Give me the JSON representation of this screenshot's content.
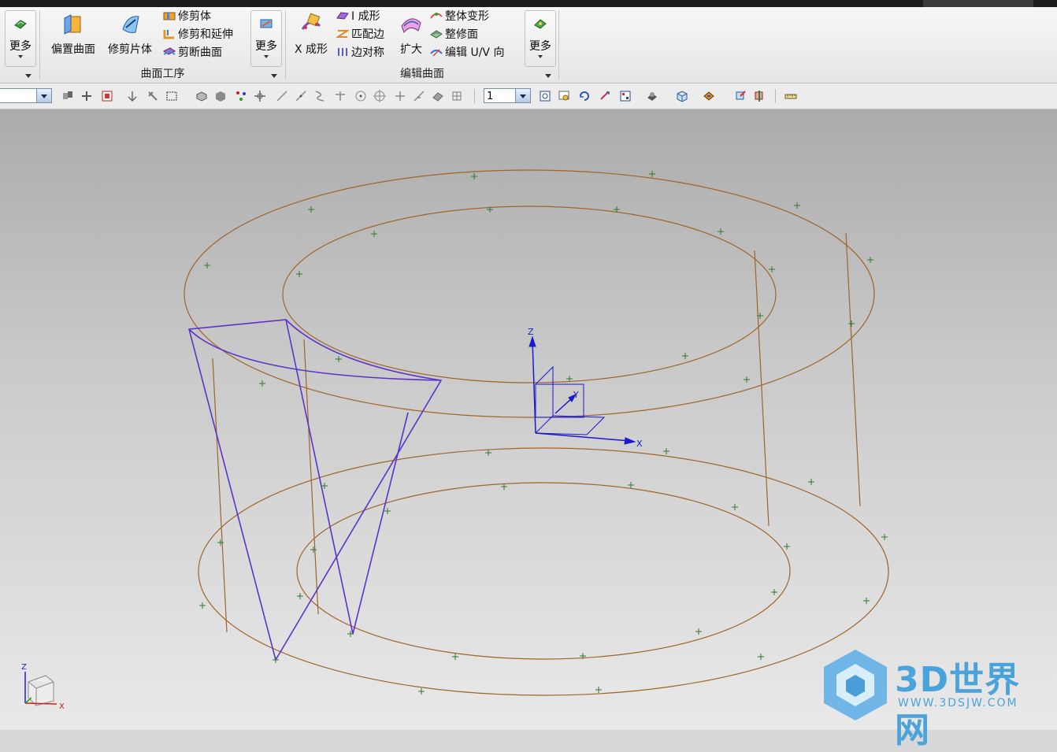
{
  "ribbon": {
    "group1": {
      "more_label": "更多"
    },
    "group2": {
      "label": "曲面工序",
      "offset_surface": "偏置曲面",
      "trim_sheet": "修剪片体",
      "trim_body": "修剪体",
      "trim_extend": "修剪和延伸",
      "divide_face": "剪断曲面",
      "more_label": "更多"
    },
    "group3": {
      "label": "编辑曲面",
      "x_form": "X 成形",
      "i_form": "I 成形",
      "match_edge": "匹配边",
      "edge_symmetry": "边对称",
      "enlarge": "扩大",
      "global_shaping": "整体变形",
      "refit_face": "整修面",
      "edit_uv": "编辑 U/V 向",
      "more_label": "更多"
    }
  },
  "toolbar": {
    "selection_filter_value": "",
    "layer_value": "1"
  },
  "viewport": {
    "axis_x": "X",
    "axis_y": "Y",
    "axis_z": "Z",
    "mini_axis_x": "X",
    "mini_axis_z": "Z"
  },
  "watermark": {
    "brand": "3D世界网",
    "url": "WWW.3DSJW.COM"
  },
  "colors": {
    "curve": "#a0642a",
    "sketch": "#5a34c8",
    "node": "#2c7a2c",
    "csys": "#1a1ad0",
    "watermark": "#4ba3dc"
  }
}
